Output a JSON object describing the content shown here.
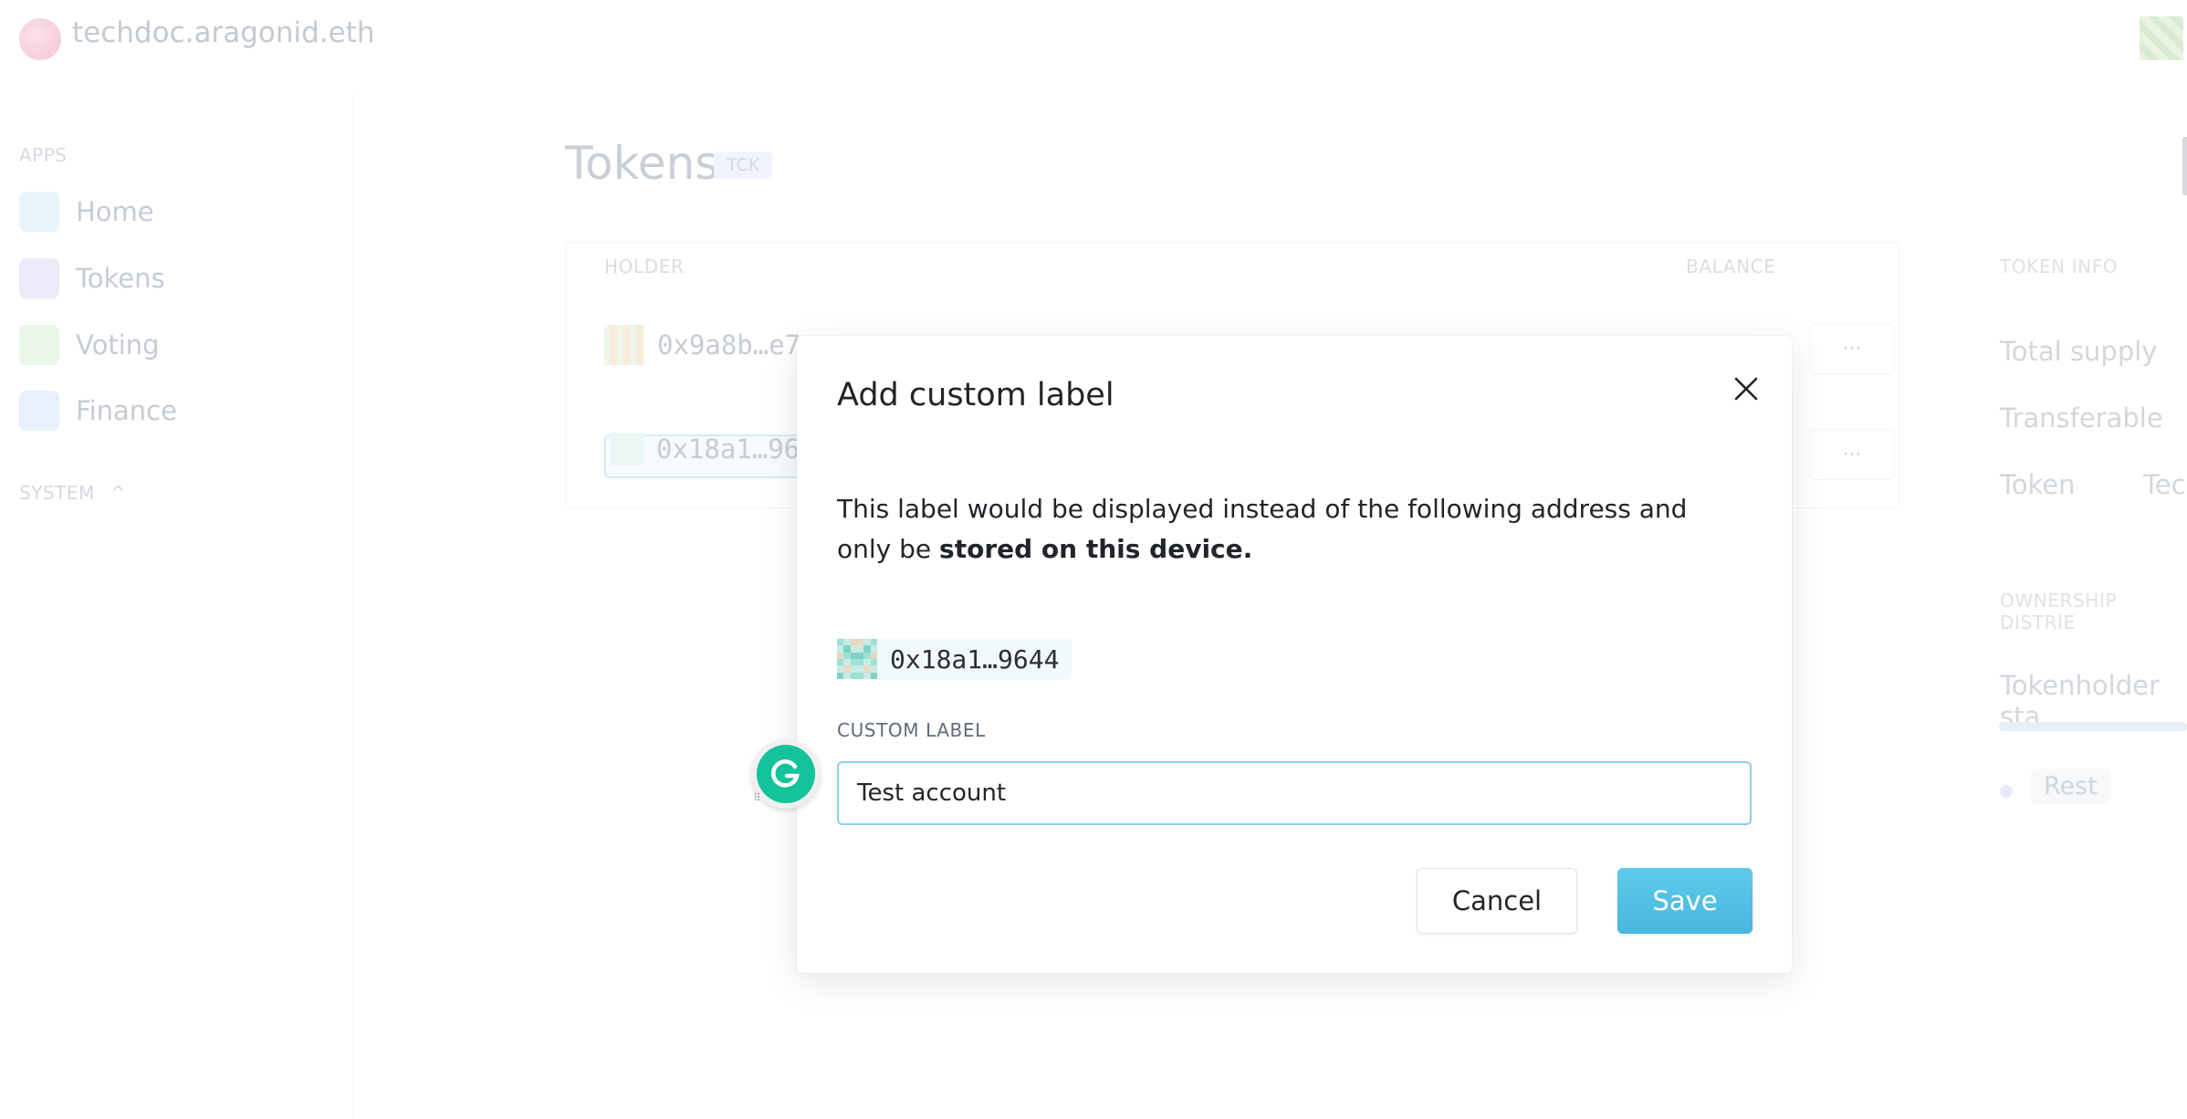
{
  "header": {
    "org_name": "techdoc.aragonid.eth"
  },
  "sidebar": {
    "apps_heading": "APPS",
    "items": [
      {
        "label": "Home",
        "icon": "home-icon",
        "color": "#e6f6f8"
      },
      {
        "label": "Tokens",
        "icon": "tokens-icon",
        "color": "#eceaf8"
      },
      {
        "label": "Voting",
        "icon": "voting-icon",
        "color": "#e8f7ea"
      },
      {
        "label": "Finance",
        "icon": "finance-icon",
        "color": "#e8f0fb"
      }
    ],
    "system_heading": "SYSTEM",
    "system_chevron": "^"
  },
  "main": {
    "title": "Tokens",
    "token_badge": "TCK",
    "table": {
      "col_holder": "HOLDER",
      "col_balance": "BALANCE",
      "rows": [
        {
          "address": "0x9a8b…e7",
          "actions": "···"
        },
        {
          "address": "0x18a1…96",
          "actions": "···"
        }
      ]
    },
    "token_info": {
      "heading": "TOKEN INFO",
      "total_supply_label": "Total supply",
      "transferable_label": "Transferable",
      "token_label": "Token",
      "token_value": "Tech"
    },
    "ownership": {
      "heading": "OWNERSHIP DISTRIE",
      "stake_label": "Tokenholder sta",
      "rest_label": "Rest"
    }
  },
  "modal": {
    "title": "Add custom label",
    "description_regular": "This label would be displayed instead of the following address and only be ",
    "description_bold": "stored on this device.",
    "address": "0x18a1…9644",
    "field_label": "CUSTOM LABEL",
    "input_value": "Test account",
    "cancel_label": "Cancel",
    "save_label": "Save"
  },
  "colors": {
    "accent": "#49b6e0",
    "input_border": "#8fd0ec",
    "grammarly": "#15c39a"
  }
}
